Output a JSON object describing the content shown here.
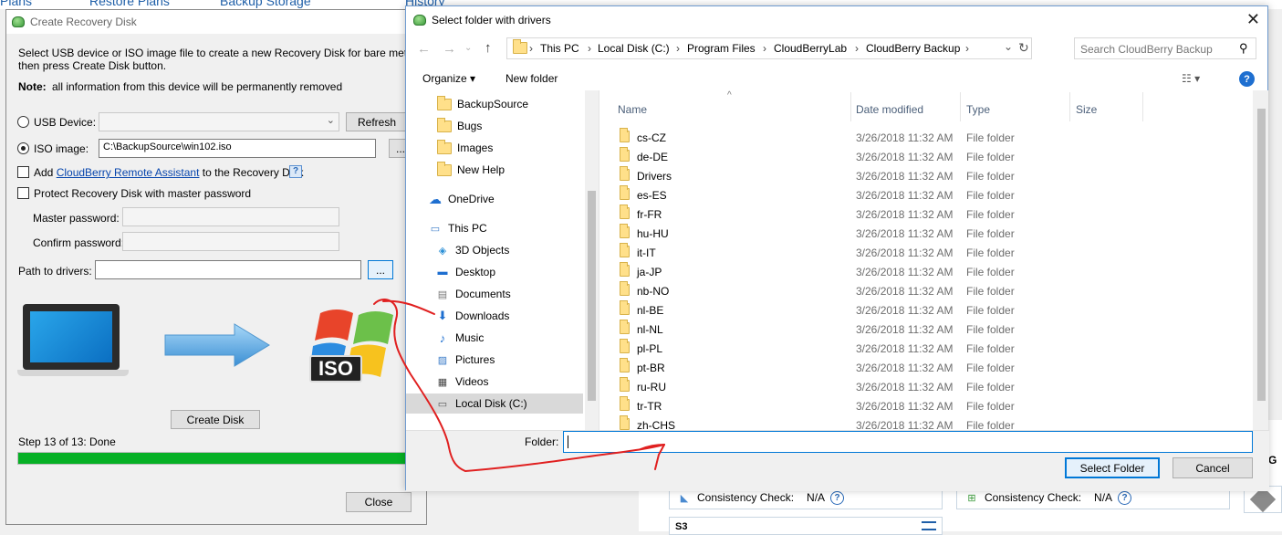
{
  "background": {
    "tabs": [
      "Plans",
      "Restore Plans",
      "Backup Storage",
      "History"
    ],
    "consistency_label": "Consistency Check:",
    "consistency_value_1": "N/A",
    "consistency_value_2": "N/A",
    "edge_letter": "G",
    "bottom_text": "S3"
  },
  "recovery": {
    "title": "Create Recovery Disk",
    "desc_line1": "Select USB device or ISO image file to create a new Recovery Disk for bare metal restore",
    "desc_line2": "then press Create Disk button.",
    "note_label": "Note:",
    "note_text": "all information from this device will be permanently removed",
    "usb_label": "USB Device:",
    "usb_value": "",
    "refresh_label": "Refresh",
    "iso_label": "ISO image:",
    "iso_value": "C:\\BackupSource\\win102.iso",
    "browse_label": "...",
    "add_prefix": "Add",
    "add_link": "CloudBerry Remote Assistant",
    "add_suffix": "to the Recovery Disk",
    "protect_label": "Protect Recovery Disk with master password",
    "master_label": "Master password:",
    "confirm_label": "Confirm password:",
    "drivers_label": "Path to drivers:",
    "drivers_value": "",
    "drivers_browse": "...",
    "iso_badge": "ISO",
    "create_label": "Create Disk",
    "step_text": "Step 13 of 13: Done",
    "progress_percent": 100,
    "close_label": "Close"
  },
  "dialog": {
    "title": "Select folder with drivers",
    "breadcrumbs": [
      "This PC",
      "Local Disk (C:)",
      "Program Files",
      "CloudBerryLab",
      "CloudBerry Backup"
    ],
    "search_placeholder": "Search CloudBerry Backup",
    "organize_label": "Organize",
    "new_folder_label": "New folder",
    "nav_items": [
      {
        "label": "BackupSource",
        "icon": "folder-icon"
      },
      {
        "label": "Bugs",
        "icon": "folder-icon"
      },
      {
        "label": "Images",
        "icon": "folder-icon"
      },
      {
        "label": "New Help",
        "icon": "folder-icon"
      },
      {
        "label": "OneDrive",
        "icon": "onedrive-icon"
      },
      {
        "label": "This PC",
        "icon": "computer-icon"
      },
      {
        "label": "3D Objects",
        "icon": "3d-objects-icon"
      },
      {
        "label": "Desktop",
        "icon": "desktop-icon"
      },
      {
        "label": "Documents",
        "icon": "documents-icon"
      },
      {
        "label": "Downloads",
        "icon": "downloads-icon"
      },
      {
        "label": "Music",
        "icon": "music-icon"
      },
      {
        "label": "Pictures",
        "icon": "pictures-icon"
      },
      {
        "label": "Videos",
        "icon": "videos-icon"
      },
      {
        "label": "Local Disk (C:)",
        "icon": "drive-icon"
      }
    ],
    "columns": [
      "Name",
      "Date modified",
      "Type",
      "Size"
    ],
    "files": [
      {
        "name": "cs-CZ",
        "date": "3/26/2018 11:32 AM",
        "type": "File folder"
      },
      {
        "name": "de-DE",
        "date": "3/26/2018 11:32 AM",
        "type": "File folder"
      },
      {
        "name": "Drivers",
        "date": "3/26/2018 11:32 AM",
        "type": "File folder"
      },
      {
        "name": "es-ES",
        "date": "3/26/2018 11:32 AM",
        "type": "File folder"
      },
      {
        "name": "fr-FR",
        "date": "3/26/2018 11:32 AM",
        "type": "File folder"
      },
      {
        "name": "hu-HU",
        "date": "3/26/2018 11:32 AM",
        "type": "File folder"
      },
      {
        "name": "it-IT",
        "date": "3/26/2018 11:32 AM",
        "type": "File folder"
      },
      {
        "name": "ja-JP",
        "date": "3/26/2018 11:32 AM",
        "type": "File folder"
      },
      {
        "name": "nb-NO",
        "date": "3/26/2018 11:32 AM",
        "type": "File folder"
      },
      {
        "name": "nl-BE",
        "date": "3/26/2018 11:32 AM",
        "type": "File folder"
      },
      {
        "name": "nl-NL",
        "date": "3/26/2018 11:32 AM",
        "type": "File folder"
      },
      {
        "name": "pl-PL",
        "date": "3/26/2018 11:32 AM",
        "type": "File folder"
      },
      {
        "name": "pt-BR",
        "date": "3/26/2018 11:32 AM",
        "type": "File folder"
      },
      {
        "name": "ru-RU",
        "date": "3/26/2018 11:32 AM",
        "type": "File folder"
      },
      {
        "name": "tr-TR",
        "date": "3/26/2018 11:32 AM",
        "type": "File folder"
      },
      {
        "name": "zh-CHS",
        "date": "3/26/2018 11:32 AM",
        "type": "File folder"
      }
    ],
    "folder_label": "Folder:",
    "folder_value": "",
    "select_label": "Select Folder",
    "cancel_label": "Cancel"
  },
  "colors": {
    "progress": "#06b025",
    "link": "#0645ad",
    "annotation": "#e02020",
    "accent": "#0078d7"
  }
}
